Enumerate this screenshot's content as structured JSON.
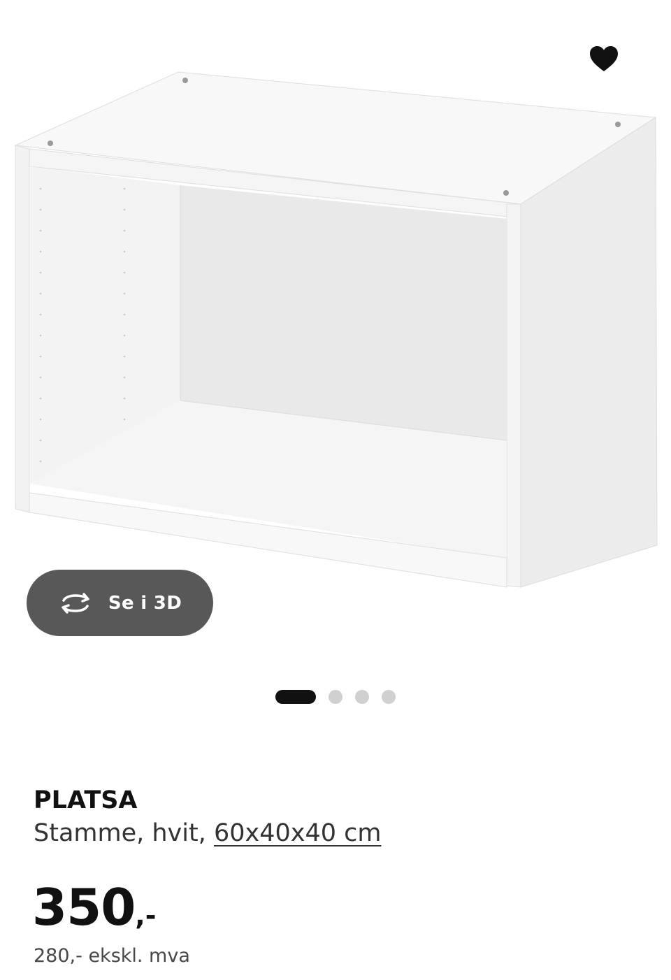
{
  "product": {
    "name": "PLATSA",
    "description": "Stamme, hvit, ",
    "measurement": "60x40x40 cm",
    "price": {
      "integer": "350",
      "suffix": ",-"
    },
    "price_excl_vat": "280,- ekskl. mva"
  },
  "gallery": {
    "view_3d_label": "Se i 3D",
    "favourite_icon": "heart-icon",
    "rotate_icon": "rotate-3d-icon",
    "dots": [
      {
        "active": true
      },
      {
        "active": false
      },
      {
        "active": false
      },
      {
        "active": false
      }
    ]
  },
  "colors": {
    "accent_dark": "#111111",
    "button_bg": "#585858",
    "dot_inactive": "#d0d0d0",
    "product_white": "#f6f6f6"
  }
}
